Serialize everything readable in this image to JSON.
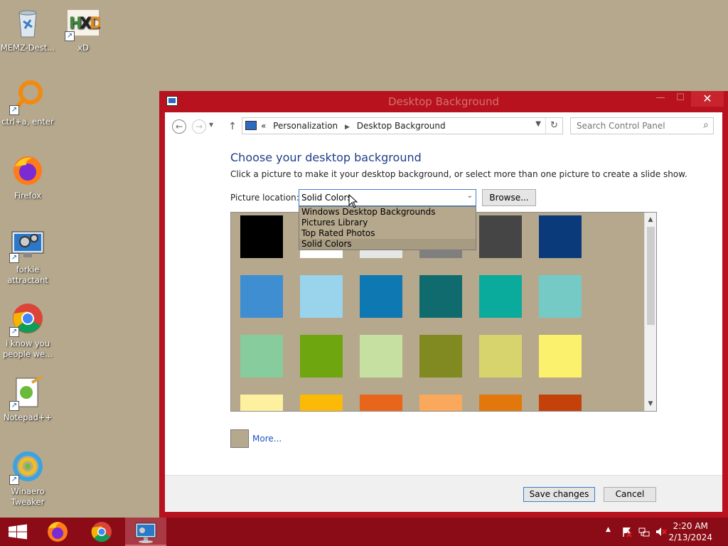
{
  "desktop": {
    "icons": [
      {
        "label": "MEMZ-Dest...",
        "icon": "recycle-bin-icon"
      },
      {
        "label": "xD",
        "icon": "hxd-icon"
      },
      {
        "label": "ctrl+a, enter",
        "icon": "search-ring-icon"
      },
      {
        "label": "Firefox",
        "icon": "firefox-icon"
      },
      {
        "label": "forkie attractant",
        "icon": "gear-monitor-icon"
      },
      {
        "label": "i know you people we...",
        "icon": "chrome-icon"
      },
      {
        "label": "Notepad++",
        "icon": "notepadpp-icon"
      },
      {
        "label": "Winaero Tweaker",
        "icon": "winaero-icon"
      }
    ]
  },
  "window": {
    "title": "Desktop Background",
    "minimize": "—",
    "maximize": "☐",
    "close": "✕"
  },
  "nav": {
    "back": "←",
    "forward": "→",
    "up": "↑",
    "breadcrumb": [
      "Personalization",
      "Desktop Background"
    ],
    "crumb_prefix": "«",
    "search_placeholder": "Search Control Panel"
  },
  "main": {
    "heading": "Choose your desktop background",
    "subtext": "Click a picture to make it your desktop background, or select more than one picture to create a slide show.",
    "location_label": "Picture location:",
    "location_value": "Solid Colors",
    "browse_label": "Browse...",
    "dropdown_options": [
      "Windows Desktop Backgrounds",
      "Pictures Library",
      "Top Rated Photos",
      "Solid Colors"
    ],
    "selected_option": "Solid Colors",
    "swatches": [
      [
        "#000000",
        "#ffffff",
        "#e6e6e6",
        "#7f7f7f",
        "#454545",
        "#0a3a7a"
      ],
      [
        "#3f8ed2",
        "#99d3ec",
        "#0d78b2",
        "#0f6b6e",
        "#0aaa9d",
        "#76cac6"
      ],
      [
        "#87cc9d",
        "#6ea60f",
        "#c5e0a0",
        "#808a21",
        "#d7d46d",
        "#fbf16c"
      ],
      [
        "#fdf1a0",
        "#fbba07",
        "#e7661c",
        "#f9a85c",
        "#e2780b",
        "#c4410a"
      ]
    ],
    "more_label": "More...",
    "more_color": "#b5a88d"
  },
  "footer": {
    "save_label": "Save changes",
    "cancel_label": "Cancel"
  },
  "taskbar": {
    "items": [
      "firefox-icon",
      "chrome-icon",
      "control-panel-icon"
    ],
    "time": "2:20 AM",
    "date": "2/13/2024"
  }
}
